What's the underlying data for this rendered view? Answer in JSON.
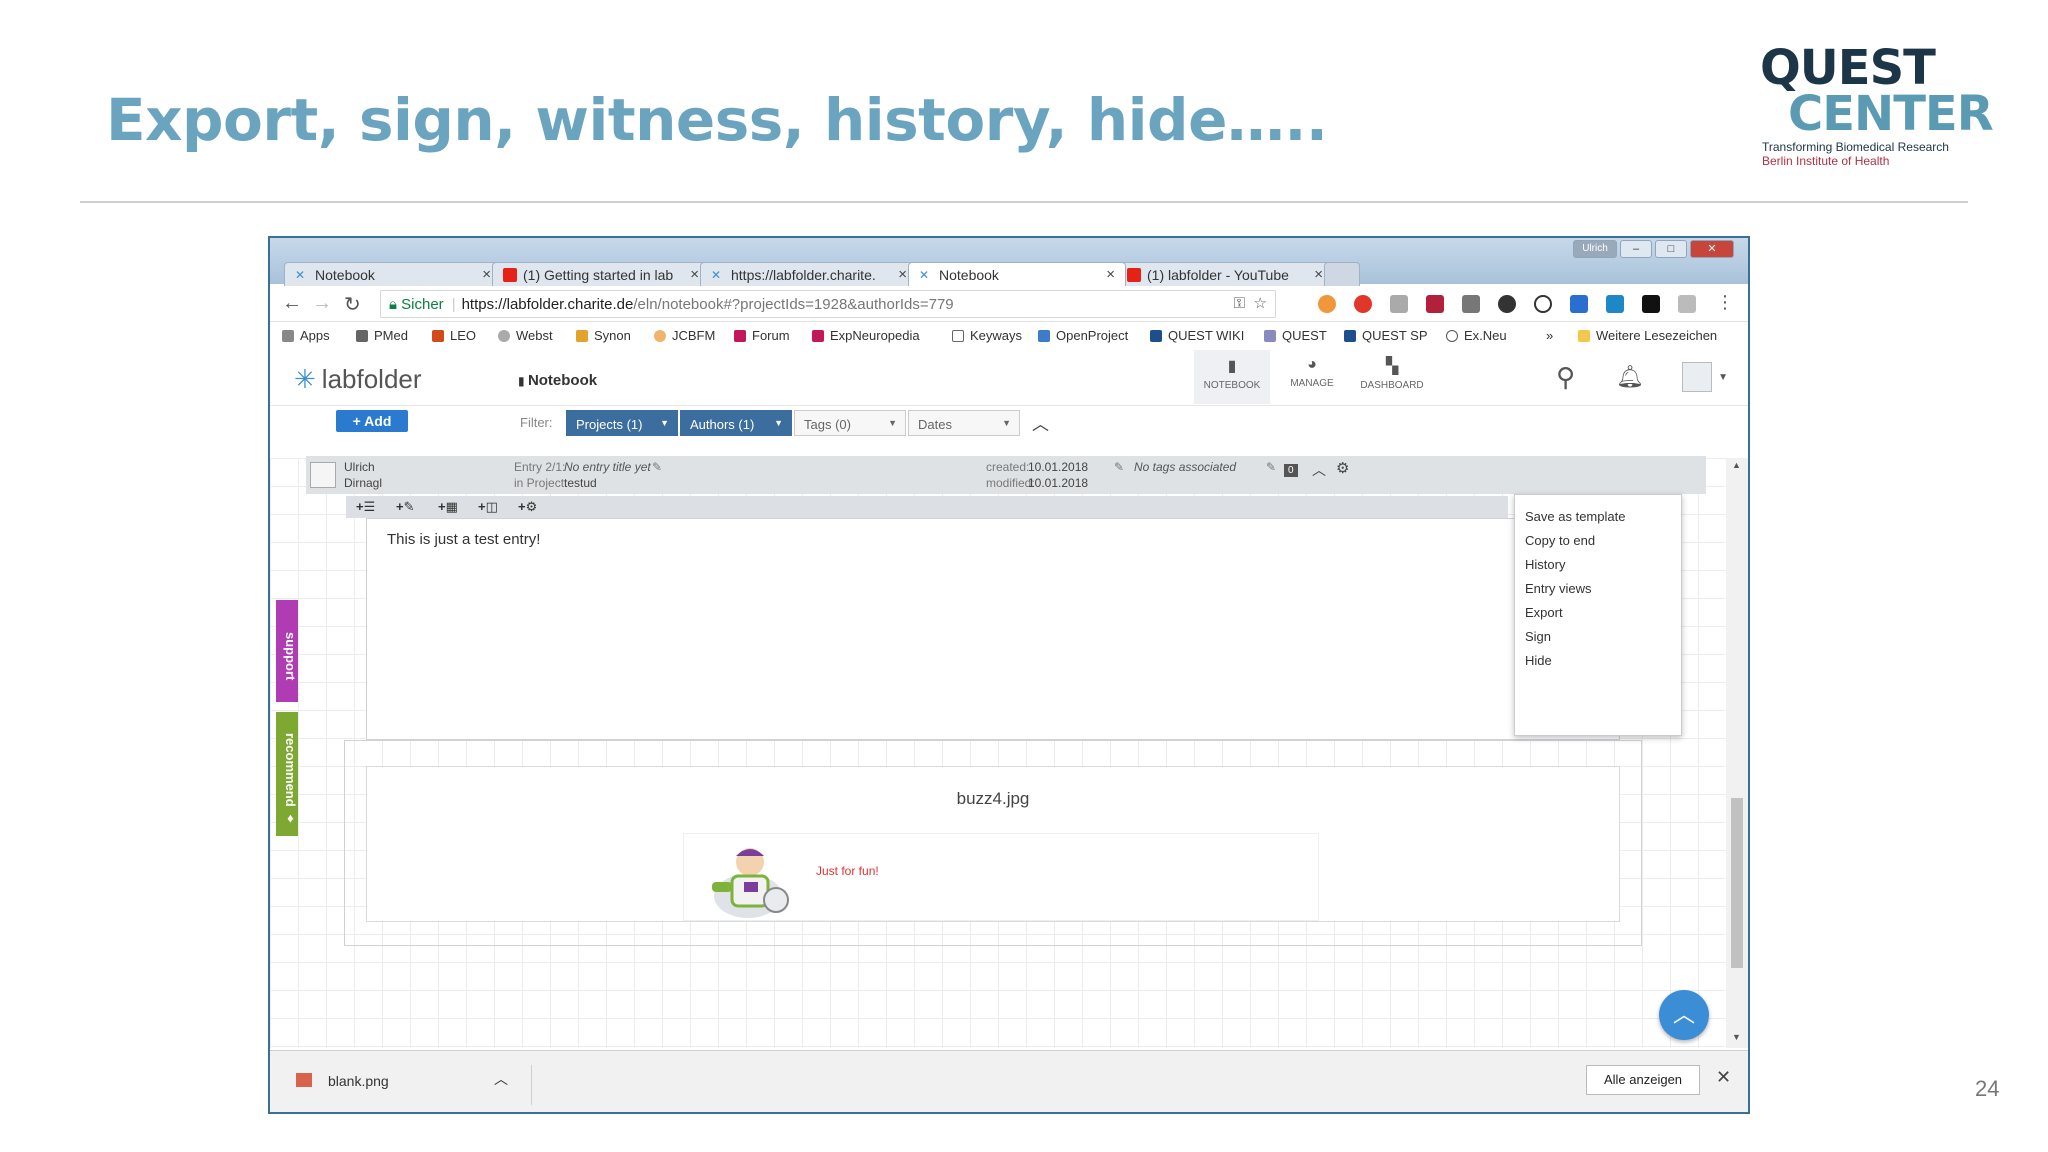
{
  "slide": {
    "title": "Export, sign, witness, history, hide…..",
    "page_number": "24",
    "logo": {
      "line1": "QUEST",
      "line2": "CENTER",
      "tagline": "Transforming Biomedical Research",
      "institute": "Berlin Institute of Health"
    }
  },
  "browser": {
    "window_user": "Ulrich",
    "tabs": [
      {
        "label": "Notebook",
        "active": false
      },
      {
        "label": "(1) Getting started in lab",
        "active": false
      },
      {
        "label": "https://labfolder.charite.",
        "active": false
      },
      {
        "label": "Notebook",
        "active": true
      },
      {
        "label": "(1) labfolder - YouTube",
        "active": false
      }
    ],
    "address": {
      "secure_label": "Sicher",
      "host": "https://labfolder.charite.de",
      "path": "/eln/notebook#?projectIds=1928&authorIds=779"
    },
    "bookmarks": [
      "Apps",
      "PMed",
      "LEO",
      "Webst",
      "Synon",
      "JCBFM",
      "Forum",
      "ExpNeuropedia",
      "Keyways",
      "OpenProject",
      "QUEST WIKI",
      "QUEST",
      "QUEST SP",
      "Ex.Neu",
      "»",
      "Weitere Lesezeichen"
    ]
  },
  "app": {
    "brand": "labfolder",
    "section": "Notebook",
    "nav": [
      {
        "label": "NOTEBOOK",
        "active": true
      },
      {
        "label": "MANAGE",
        "active": false
      },
      {
        "label": "DASHBOARD",
        "active": false
      }
    ],
    "add_label": "+ Add",
    "filter_label": "Filter:",
    "filters": [
      {
        "label": "Projects (1)",
        "active": true
      },
      {
        "label": "Authors (1)",
        "active": true
      },
      {
        "label": "Tags (0)",
        "active": false
      },
      {
        "label": "Dates",
        "active": false
      }
    ],
    "side_tabs": {
      "support": "support",
      "recommend": "recommend ♦"
    },
    "entry": {
      "author_first": "Ulrich",
      "author_last": "Dirnagl",
      "entry_label": "Entry 2/1:",
      "entry_title": "No entry title yet",
      "project_label": "in Project:",
      "project": "testud",
      "created_label": "created:",
      "created": "10.01.2018",
      "modified_label": "modified:",
      "modified": "10.01.2018",
      "tags": "No tags associated",
      "comment_count": "0",
      "tools": [
        "+☰",
        "+✎",
        "+▦",
        "+◫",
        "+⚙"
      ],
      "text": "This is just a test entry!",
      "image_name": "buzz4.jpg",
      "image_caption": "Just for fun!"
    },
    "entry_menu": [
      "Save as template",
      "Copy to end",
      "History",
      "Entry views",
      "Export",
      "Sign",
      "Hide"
    ]
  },
  "download_bar": {
    "file": "blank.png",
    "show_all": "Alle anzeigen"
  },
  "colors": {
    "title": "#6aa4bf",
    "filter_active": "#3c6d9f",
    "add_button": "#2a7bd0",
    "support_tab": "#b03cb3",
    "recommend_tab": "#7da932"
  }
}
